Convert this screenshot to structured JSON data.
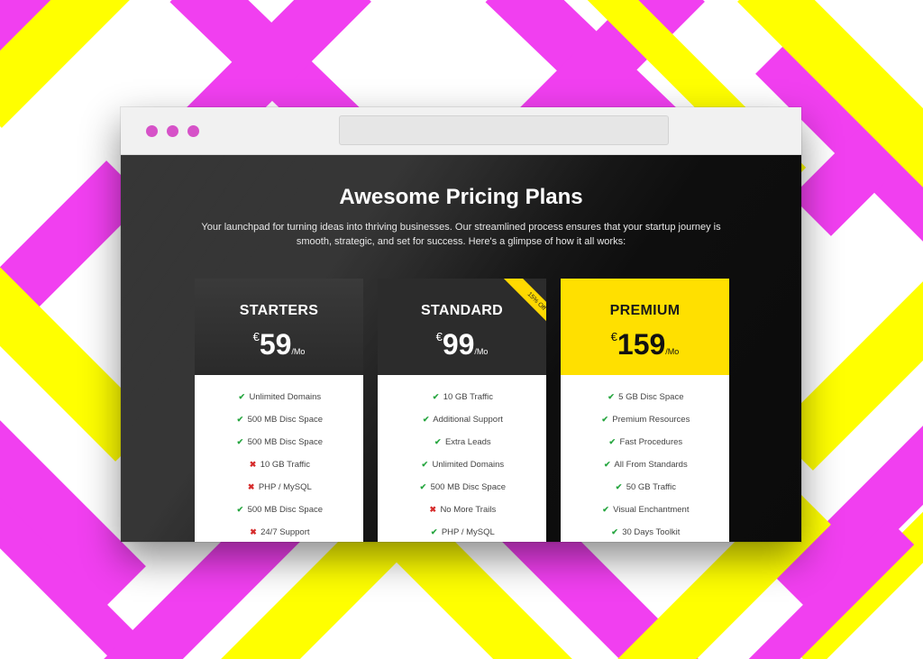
{
  "window": {
    "dots": [
      "#d652c8",
      "#d652c8",
      "#d652c8"
    ],
    "address_bar": ""
  },
  "header": {
    "title": "Awesome Pricing Plans",
    "subtitle": "Your launchpad for turning ideas into thriving businesses. Our streamlined process ensures that your startup journey is smooth, strategic, and set for success. Here's a glimpse of how it all works:"
  },
  "colors": {
    "magenta": "#f13ff0",
    "yellow": "#ffff00",
    "premium": "#ffe000",
    "check": "#27a640",
    "cross": "#d62c2c"
  },
  "plans": [
    {
      "name": "STARTERS",
      "currency": "€",
      "amount": "59",
      "period": "/Mo",
      "features": [
        {
          "label": "Unlimited Domains",
          "included": true,
          "icon": "check-icon",
          "glyph": "✔"
        },
        {
          "label": "500 MB Disc Space",
          "included": true,
          "icon": "check-icon",
          "glyph": "✔"
        },
        {
          "label": "500 MB Disc Space",
          "included": true,
          "icon": "check-icon",
          "glyph": "✔"
        },
        {
          "label": "10 GB Traffic",
          "included": false,
          "icon": "cross-icon",
          "glyph": "✖"
        },
        {
          "label": "PHP / MySQL",
          "included": false,
          "icon": "cross-icon",
          "glyph": "✖"
        },
        {
          "label": "500 MB Disc Space",
          "included": true,
          "icon": "check-icon",
          "glyph": "✔"
        },
        {
          "label": "24/7 Support",
          "included": false,
          "icon": "cross-icon",
          "glyph": "✖"
        }
      ]
    },
    {
      "name": "STANDARD",
      "currency": "€",
      "amount": "99",
      "period": "/Mo",
      "ribbon": "15% Off",
      "features": [
        {
          "label": "10 GB Traffic",
          "included": true,
          "icon": "check-icon",
          "glyph": "✔"
        },
        {
          "label": "Additional Support",
          "included": true,
          "icon": "check-icon",
          "glyph": "✔"
        },
        {
          "label": "Extra Leads",
          "included": true,
          "icon": "check-icon",
          "glyph": "✔"
        },
        {
          "label": "Unlimited Domains",
          "included": true,
          "icon": "check-icon",
          "glyph": "✔"
        },
        {
          "label": "500 MB Disc Space",
          "included": true,
          "icon": "check-icon",
          "glyph": "✔"
        },
        {
          "label": "No More Trails",
          "included": false,
          "icon": "cross-icon",
          "glyph": "✖"
        },
        {
          "label": "PHP / MySQL",
          "included": true,
          "icon": "check-icon",
          "glyph": "✔"
        }
      ]
    },
    {
      "name": "PREMIUM",
      "currency": "€",
      "amount": "159",
      "period": "/Mo",
      "features": [
        {
          "label": "5 GB Disc Space",
          "included": true,
          "icon": "check-icon",
          "glyph": "✔"
        },
        {
          "label": "Premium Resources",
          "included": true,
          "icon": "check-icon",
          "glyph": "✔"
        },
        {
          "label": "Fast Procedures",
          "included": true,
          "icon": "check-icon",
          "glyph": "✔"
        },
        {
          "label": "All From Standards",
          "included": true,
          "icon": "check-icon",
          "glyph": "✔"
        },
        {
          "label": "50 GB Traffic",
          "included": true,
          "icon": "check-icon",
          "glyph": "✔"
        },
        {
          "label": "Visual Enchantment",
          "included": true,
          "icon": "check-icon",
          "glyph": "✔"
        },
        {
          "label": "30 Days Toolkit",
          "included": true,
          "icon": "check-icon",
          "glyph": "✔"
        }
      ]
    }
  ]
}
